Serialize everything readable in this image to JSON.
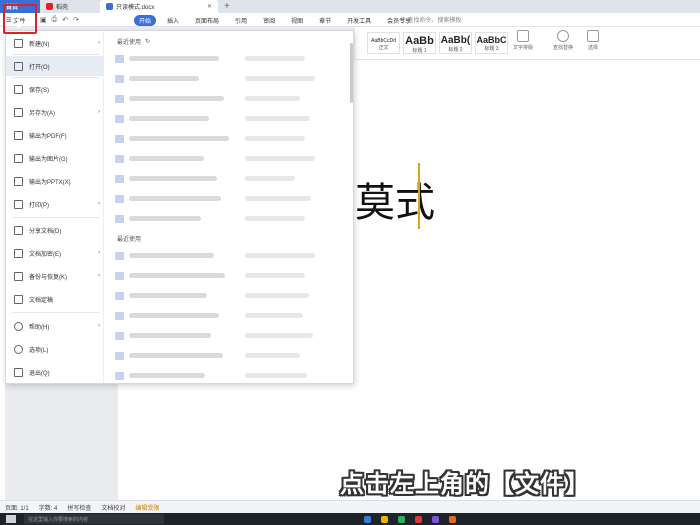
{
  "tabs": {
    "home_label": "首页",
    "straw_label": "稻壳",
    "doc_label": "只读模式.docx",
    "new_tab": "+"
  },
  "menubar": {
    "file_label": "文件",
    "tabs": [
      "开始",
      "插入",
      "页面布局",
      "引用",
      "审阅",
      "视图",
      "章节",
      "开发工具",
      "会员专享"
    ],
    "search_placeholder": "查找命令、搜索模板"
  },
  "ribbon": {
    "styles": [
      {
        "sample": "AaBbCcDd",
        "name": "正文"
      },
      {
        "sample": "AaBb",
        "name": "标题 1"
      },
      {
        "sample": "AaBb(",
        "name": "标题 2"
      },
      {
        "sample": "AaBbC",
        "name": "标题 3"
      }
    ],
    "tools": [
      "文字排版",
      "查找替换",
      "选择"
    ]
  },
  "file_menu": {
    "items": [
      {
        "label": "新建(N)",
        "icon": "new-doc-icon",
        "arrow": true
      },
      {
        "label": "打开(O)",
        "icon": "folder-open-icon",
        "arrow": false,
        "selected": true
      },
      {
        "label": "保存(S)",
        "icon": "save-icon",
        "arrow": false
      },
      {
        "label": "另存为(A)",
        "icon": "save-as-icon",
        "arrow": true
      },
      {
        "label": "输出为PDF(F)",
        "icon": "pdf-icon",
        "arrow": false
      },
      {
        "label": "输出为图片(G)",
        "icon": "image-icon",
        "arrow": false
      },
      {
        "label": "输出为PPTX(X)",
        "icon": "pptx-icon",
        "arrow": false
      },
      {
        "label": "打印(P)",
        "icon": "print-icon",
        "arrow": true
      },
      {
        "label": "分享文档(D)",
        "icon": "share-icon",
        "arrow": false
      },
      {
        "label": "文档加密(E)",
        "icon": "lock-icon",
        "arrow": true
      },
      {
        "label": "备份与恢复(K)",
        "icon": "backup-icon",
        "arrow": true
      },
      {
        "label": "文档定稿",
        "icon": "finalize-icon",
        "arrow": false
      },
      {
        "label": "帮助(H)",
        "icon": "help-icon",
        "arrow": true
      },
      {
        "label": "选项(L)",
        "icon": "options-icon",
        "arrow": false
      },
      {
        "label": "退出(Q)",
        "icon": "exit-icon",
        "arrow": false
      }
    ],
    "recent_header": "最近使用",
    "recent_header_2": "最近使用"
  },
  "document": {
    "visible_text": "莫式",
    "subtitle": "点击左上角的【文件】"
  },
  "statusbar": {
    "page": "页面: 1/1",
    "words": "字数: 4",
    "spell": "拼写检查",
    "proof": "文档校对",
    "warning": "编辑受限"
  },
  "taskbar": {
    "search_placeholder": "在这里输入你要搜索的内容"
  },
  "colors": {
    "accent": "#3b6fd8",
    "highlight_frame": "#e0202a"
  }
}
